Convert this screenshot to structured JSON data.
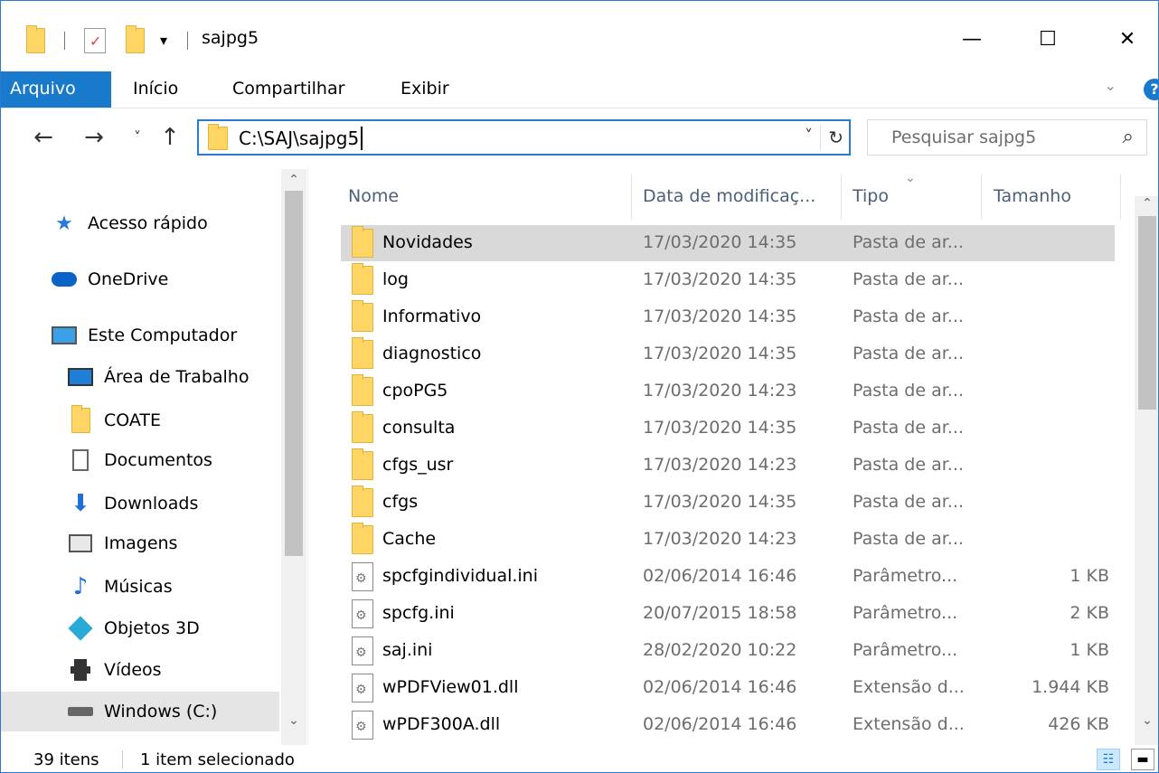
{
  "window": {
    "title": "sajpg5",
    "minimize": "—",
    "maximize": "☐",
    "close": "✕",
    "qa_dropdown": "▾"
  },
  "ribbon": {
    "tabs": [
      "Arquivo",
      "Início",
      "Compartilhar",
      "Exibir"
    ],
    "active_tab": "Arquivo",
    "expand_icon": "chevron-down-icon",
    "help": "?"
  },
  "nav": {
    "back": "←",
    "forward": "→",
    "recent": "˅",
    "up": "↑",
    "address": "C:\\SAJ\\sajpg5",
    "address_dropdown": "˅",
    "refresh": "↻",
    "search_placeholder": "Pesquisar sajpg5",
    "search_icon": "⌕"
  },
  "sidebar": {
    "items": [
      {
        "label": "Acesso rápido",
        "icon": "star-icon"
      },
      {
        "label": "OneDrive",
        "icon": "cloud-icon"
      },
      {
        "label": "Este Computador",
        "icon": "computer-icon"
      },
      {
        "label": "Área de Trabalho",
        "icon": "desktop-icon"
      },
      {
        "label": "COATE",
        "icon": "folder-icon"
      },
      {
        "label": "Documentos",
        "icon": "document-icon"
      },
      {
        "label": "Downloads",
        "icon": "download-icon"
      },
      {
        "label": "Imagens",
        "icon": "pictures-icon"
      },
      {
        "label": "Músicas",
        "icon": "music-icon"
      },
      {
        "label": "Objetos 3D",
        "icon": "cube-icon"
      },
      {
        "label": "Vídeos",
        "icon": "video-icon"
      },
      {
        "label": "Windows (C:)",
        "icon": "drive-icon"
      }
    ],
    "selected": "Windows (C:)",
    "scroll_up": "⌃",
    "scroll_down": "⌄"
  },
  "list": {
    "columns": [
      "Nome",
      "Data de modificaç...",
      "Tipo",
      "Tamanho"
    ],
    "sort_indicator": "⌄",
    "rows": [
      {
        "name": "Novidades",
        "date": "17/03/2020 14:35",
        "type": "Pasta de ar...",
        "size": "",
        "kind": "folder",
        "selected": true
      },
      {
        "name": "log",
        "date": "17/03/2020 14:35",
        "type": "Pasta de ar...",
        "size": "",
        "kind": "folder"
      },
      {
        "name": "Informativo",
        "date": "17/03/2020 14:35",
        "type": "Pasta de ar...",
        "size": "",
        "kind": "folder"
      },
      {
        "name": "diagnostico",
        "date": "17/03/2020 14:35",
        "type": "Pasta de ar...",
        "size": "",
        "kind": "folder"
      },
      {
        "name": "cpoPG5",
        "date": "17/03/2020 14:23",
        "type": "Pasta de ar...",
        "size": "",
        "kind": "folder"
      },
      {
        "name": "consulta",
        "date": "17/03/2020 14:35",
        "type": "Pasta de ar...",
        "size": "",
        "kind": "folder"
      },
      {
        "name": "cfgs_usr",
        "date": "17/03/2020 14:23",
        "type": "Pasta de ar...",
        "size": "",
        "kind": "folder"
      },
      {
        "name": "cfgs",
        "date": "17/03/2020 14:35",
        "type": "Pasta de ar...",
        "size": "",
        "kind": "folder"
      },
      {
        "name": "Cache",
        "date": "17/03/2020 14:23",
        "type": "Pasta de ar...",
        "size": "",
        "kind": "folder"
      },
      {
        "name": "spcfgindividual.ini",
        "date": "02/06/2014 16:46",
        "type": "Parâmetro...",
        "size": "1 KB",
        "kind": "file"
      },
      {
        "name": "spcfg.ini",
        "date": "20/07/2015 18:58",
        "type": "Parâmetro...",
        "size": "2 KB",
        "kind": "file"
      },
      {
        "name": "saj.ini",
        "date": "28/02/2020 10:22",
        "type": "Parâmetro...",
        "size": "1 KB",
        "kind": "file"
      },
      {
        "name": "wPDFView01.dll",
        "date": "02/06/2014 16:46",
        "type": "Extensão d...",
        "size": "1.944 KB",
        "kind": "file"
      },
      {
        "name": "wPDF300A.dll",
        "date": "02/06/2014 16:46",
        "type": "Extensão d...",
        "size": "426 KB",
        "kind": "file"
      }
    ]
  },
  "status": {
    "count": "39 itens",
    "selection": "1 item selecionado"
  },
  "colors": {
    "accent": "#1979ca",
    "folder": "#ffd663",
    "selected_row": "#d9d9d9"
  }
}
